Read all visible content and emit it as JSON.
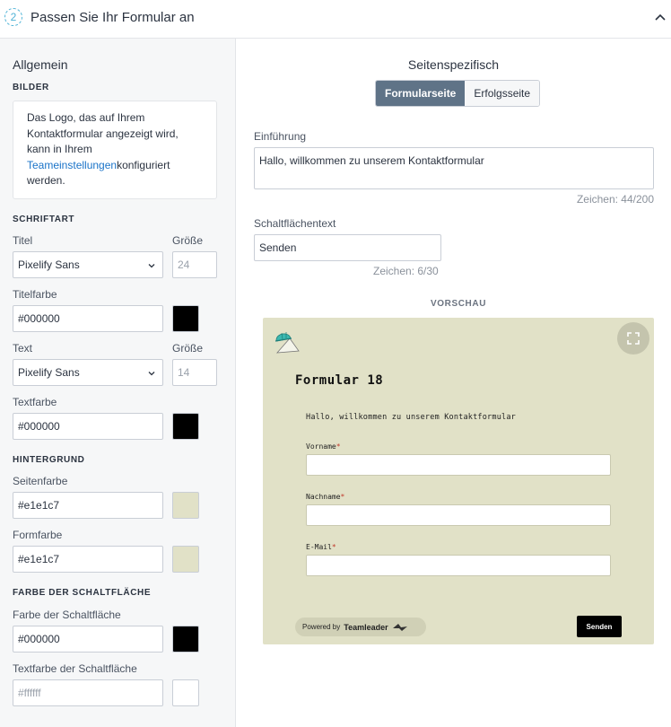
{
  "header": {
    "step": "2",
    "title": "Passen Sie Ihr Formular an"
  },
  "left": {
    "section_general": "Allgemein",
    "images": {
      "title": "BILDER",
      "info_part1": "Das Logo, das auf Ihrem Kontaktformular angezeigt wird, kann in Ihrem ",
      "info_link": "Teameinstellungen",
      "info_part2": "konfiguriert werden."
    },
    "font": {
      "title": "SCHRIFTART",
      "title_label": "Titel",
      "size_label": "Größe",
      "title_font": "Pixelify Sans",
      "title_size": "24",
      "title_color_label": "Titelfarbe",
      "title_color": "#000000",
      "text_label": "Text",
      "text_size_label": "Größe",
      "text_font": "Pixelify Sans",
      "text_size": "14",
      "text_color_label": "Textfarbe",
      "text_color": "#000000"
    },
    "background": {
      "title": "HINTERGRUND",
      "page_color_label": "Seitenfarbe",
      "page_color": "#e1e1c7",
      "form_color_label": "Formfarbe",
      "form_color": "#e1e1c7"
    },
    "button_color": {
      "title": "FARBE DER SCHALTFLÄCHE",
      "color_label": "Farbe der Schaltfläche",
      "color": "#000000",
      "text_color_label": "Textfarbe der Schaltfläche",
      "text_color": "#ffffff"
    }
  },
  "right": {
    "title": "Seitenspezifisch",
    "tabs": [
      {
        "label": "Formularseite",
        "active": true
      },
      {
        "label": "Erfolgsseite",
        "active": false
      }
    ],
    "intro_label": "Einführung",
    "intro_value": "Hallo, willkommen zu unserem Kontaktformular",
    "intro_counter": "Zeichen: 44/200",
    "button_text_label": "Schaltflächentext",
    "button_text_value": "Senden",
    "button_text_counter": "Zeichen: 6/30"
  },
  "preview": {
    "label": "VORSCHAU",
    "form_title": "Formular 18",
    "intro": "Hallo, willkommen zu unserem Kontaktformular",
    "fields": [
      "Vorname",
      "Nachname",
      "E-Mail"
    ],
    "required_mark": "*",
    "powered_by": "Powered by",
    "brand": "Teamleader",
    "send_label": "Senden"
  },
  "colors": {
    "accent": "#1a73c8",
    "tab_active": "#5f7387",
    "canvas": "#e1e1c7",
    "black": "#000000",
    "white": "#ffffff"
  },
  "icons": {
    "collapse": "chevron-up-icon",
    "select": "chevron-down-icon",
    "expand": "fullscreen-icon",
    "logo": "helmet-logo-icon"
  }
}
